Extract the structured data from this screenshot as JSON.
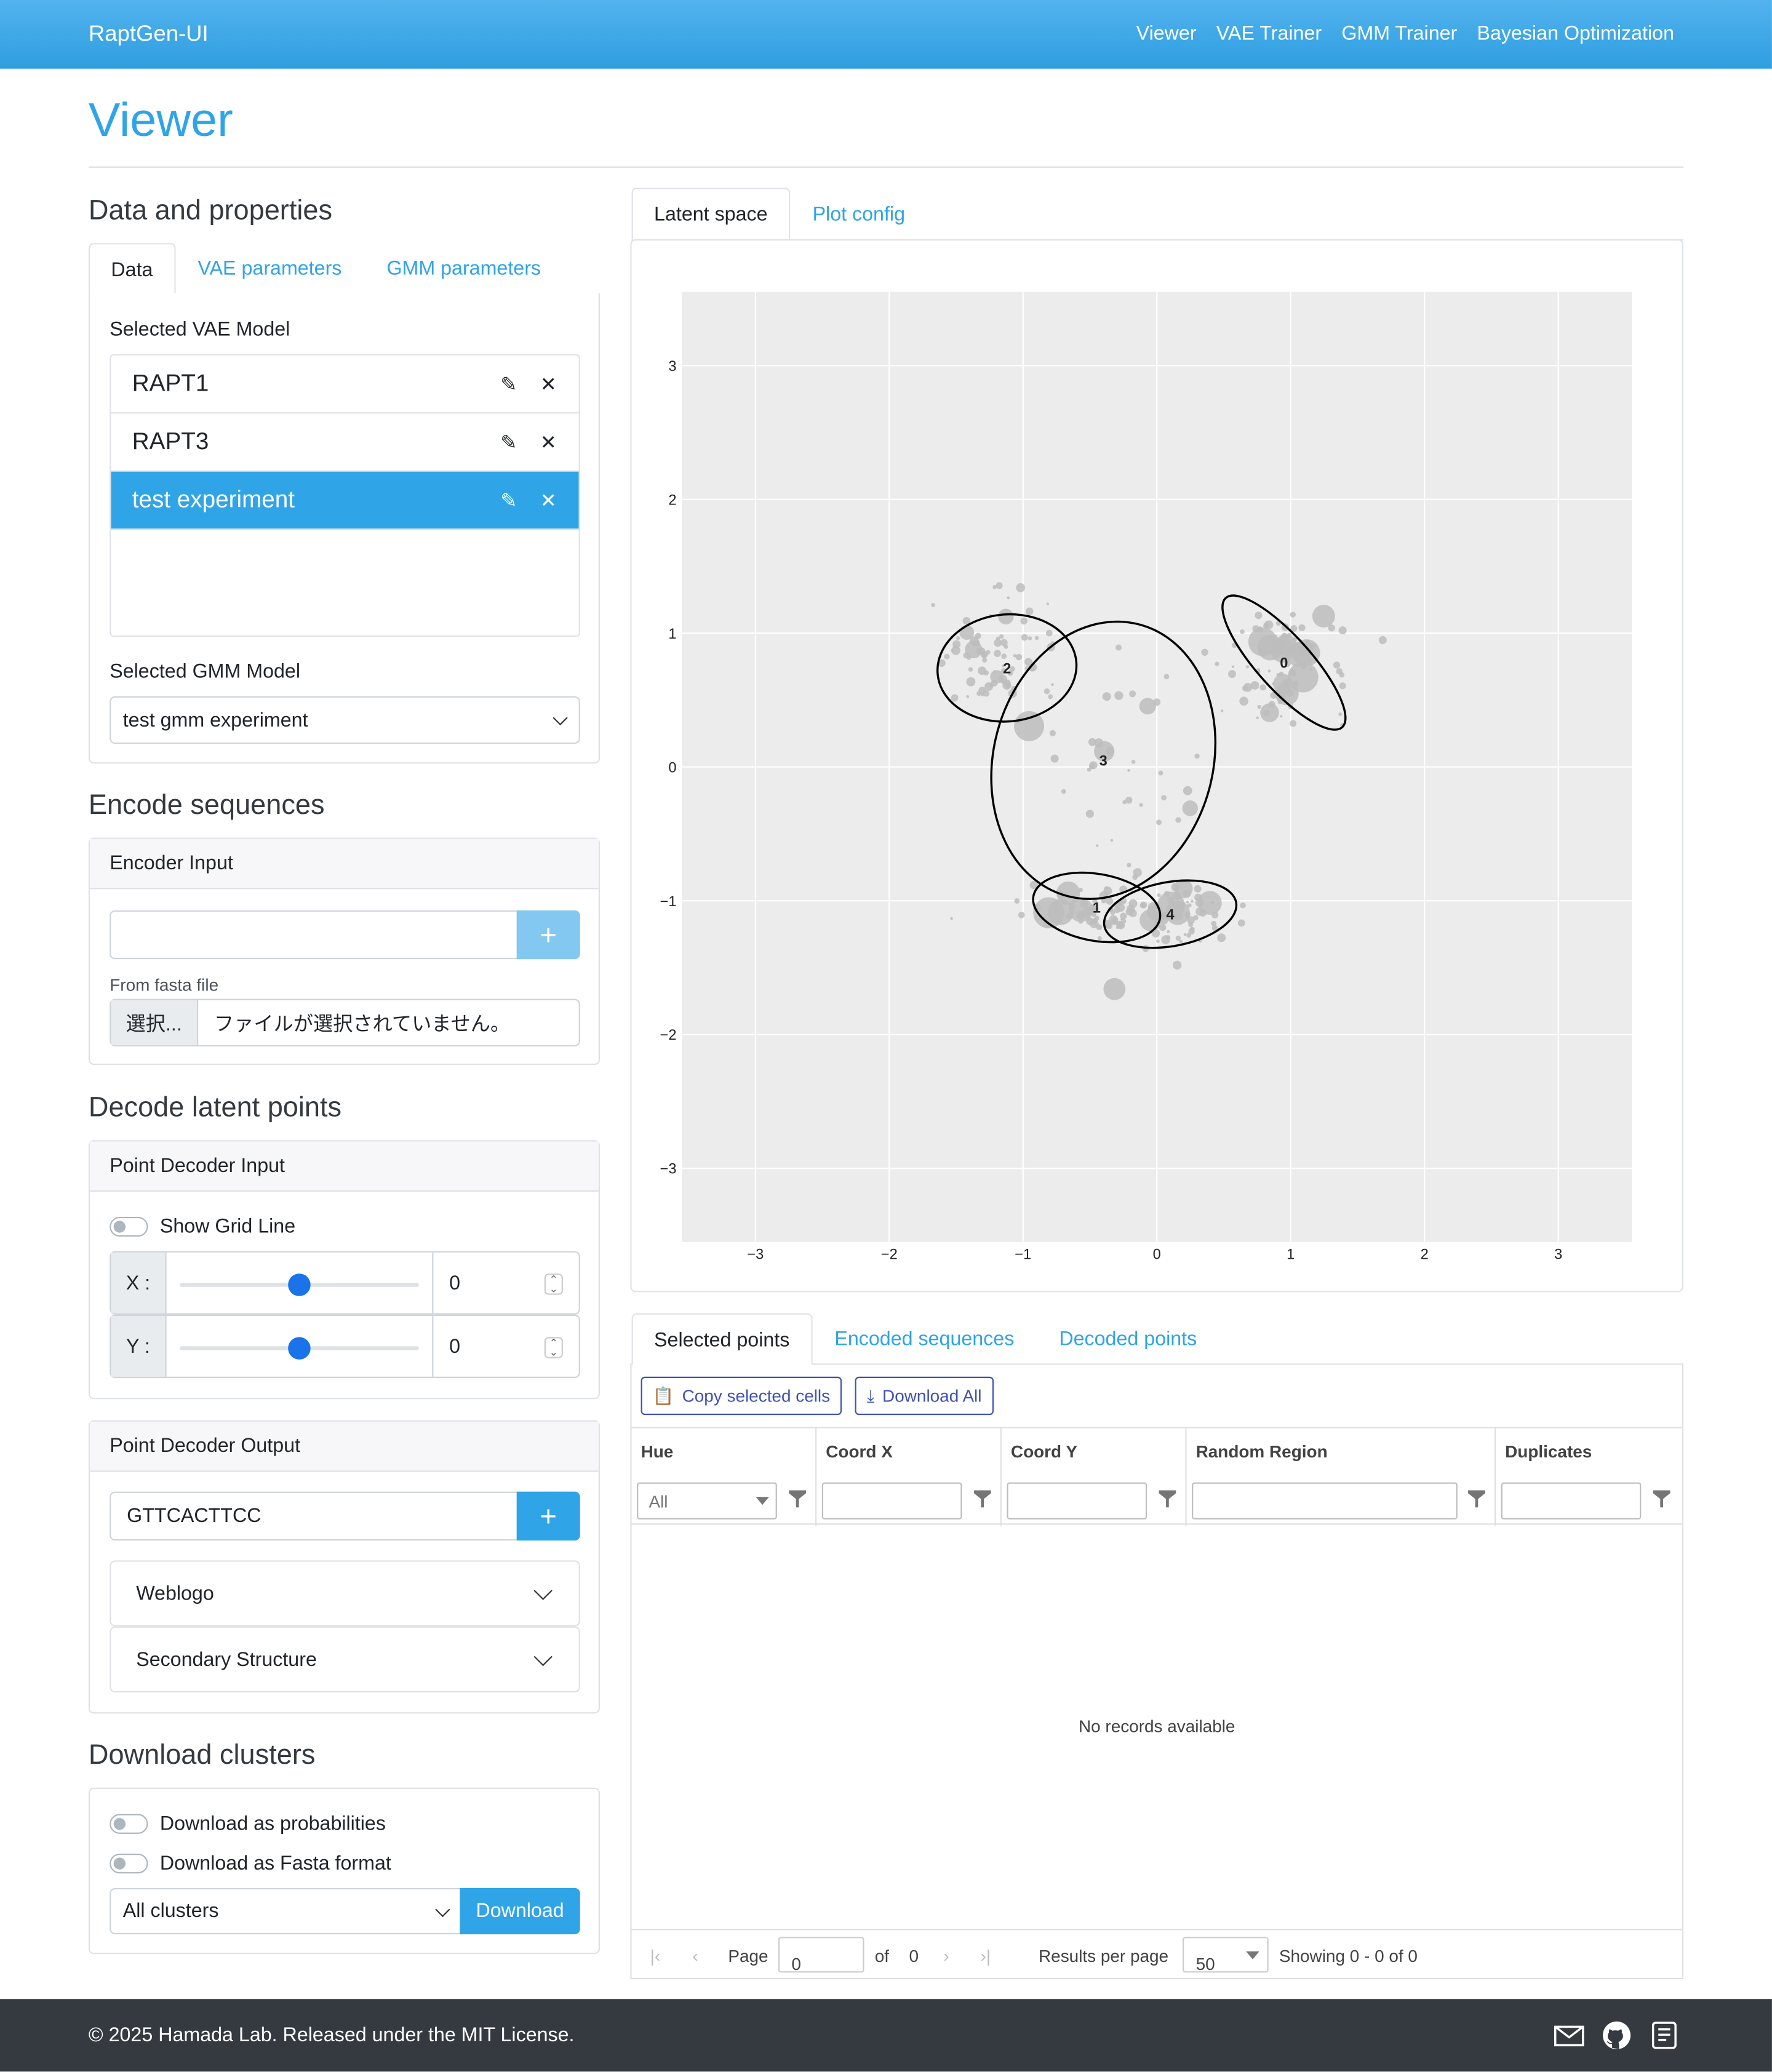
{
  "navbar": {
    "brand": "RaptGen-UI",
    "links": [
      "Viewer",
      "VAE Trainer",
      "GMM Trainer",
      "Bayesian Optimization"
    ]
  },
  "page_title": "Viewer",
  "left": {
    "data_props": {
      "heading": "Data and properties",
      "tabs": [
        "Data",
        "VAE parameters",
        "GMM parameters"
      ],
      "vae_label": "Selected VAE Model",
      "vae_models": [
        "RAPT1",
        "RAPT3",
        "test experiment"
      ],
      "vae_selected": "test experiment",
      "gmm_label": "Selected GMM Model",
      "gmm_selected": "test gmm experiment"
    },
    "encode": {
      "heading": "Encode sequences",
      "card_title": "Encoder Input",
      "input_value": "",
      "add": "+",
      "fasta_label": "From fasta file",
      "file_button": "選択...",
      "file_status": "ファイルが選択されていません。"
    },
    "decode": {
      "heading": "Decode latent points",
      "card_title": "Point Decoder Input",
      "grid_toggle": "Show Grid Line",
      "x_label": "X :",
      "y_label": "Y :",
      "x_value": "0",
      "y_value": "0",
      "slider_x_fraction": 0.5,
      "slider_y_fraction": 0.5
    },
    "decoder_output": {
      "card_title": "Point Decoder Output",
      "value": "GTTCACTTCC",
      "add": "+",
      "weblogo": "Weblogo",
      "secondary": "Secondary Structure"
    },
    "download": {
      "heading": "Download clusters",
      "prob_toggle": "Download as probabilities",
      "fasta_toggle": "Download as Fasta format",
      "cluster_select": "All clusters",
      "button": "Download"
    }
  },
  "plot": {
    "tabs": [
      "Latent space",
      "Plot config"
    ],
    "x_ticks": [
      "−3",
      "−2",
      "−1",
      "0",
      "1",
      "2",
      "3"
    ],
    "y_ticks": [
      "3",
      "2",
      "1",
      "0",
      "−1",
      "−2",
      "−3"
    ]
  },
  "chart_data": {
    "type": "scatter",
    "xlim": [
      -3.55,
      3.55
    ],
    "ylim": [
      -3.55,
      3.55
    ],
    "grid": true,
    "gmm_components": [
      {
        "label": "0",
        "cx": 0.95,
        "cy": 0.78,
        "rx": 0.65,
        "ry": 0.2,
        "angle_deg": -48
      },
      {
        "label": "1",
        "cx": -0.45,
        "cy": -1.05,
        "rx": 0.48,
        "ry": 0.25,
        "angle_deg": -10
      },
      {
        "label": "2",
        "cx": -1.12,
        "cy": 0.74,
        "rx": 0.52,
        "ry": 0.4,
        "angle_deg": 5
      },
      {
        "label": "3",
        "cx": -0.4,
        "cy": 0.05,
        "rx": 0.82,
        "ry": 1.05,
        "angle_deg": -15
      },
      {
        "label": "4",
        "cx": 0.1,
        "cy": -1.1,
        "rx": 0.5,
        "ry": 0.24,
        "angle_deg": 10
      }
    ],
    "point_clusters": [
      {
        "cx": -1.22,
        "cy": 0.8,
        "sx": 0.3,
        "sy": 0.3,
        "n": 80
      },
      {
        "cx": 0.95,
        "cy": 0.78,
        "sx": 0.3,
        "sy": 0.25,
        "n": 90
      },
      {
        "cx": -0.3,
        "cy": 0.05,
        "sx": 0.35,
        "sy": 0.5,
        "n": 35
      },
      {
        "cx": -0.4,
        "cy": -1.1,
        "sx": 0.35,
        "sy": 0.12,
        "n": 70
      },
      {
        "cx": 0.15,
        "cy": -1.1,
        "sx": 0.3,
        "sy": 0.15,
        "n": 60
      }
    ]
  },
  "results": {
    "tabs": [
      "Selected points",
      "Encoded sequences",
      "Decoded points"
    ],
    "copy_btn": "Copy selected cells",
    "download_btn": "Download All",
    "columns": [
      "Hue",
      "Coord X",
      "Coord Y",
      "Random Region",
      "Duplicates"
    ],
    "hue_filter": "All",
    "empty": "No records available",
    "pager": {
      "page_label": "Page",
      "page": "0",
      "of_label": "of",
      "total": "0",
      "per_page_label": "Results per page",
      "per_page": "50",
      "showing": "Showing 0 - 0 of 0"
    }
  },
  "footer": {
    "text": "© 2025 Hamada Lab. Released under the MIT License."
  }
}
